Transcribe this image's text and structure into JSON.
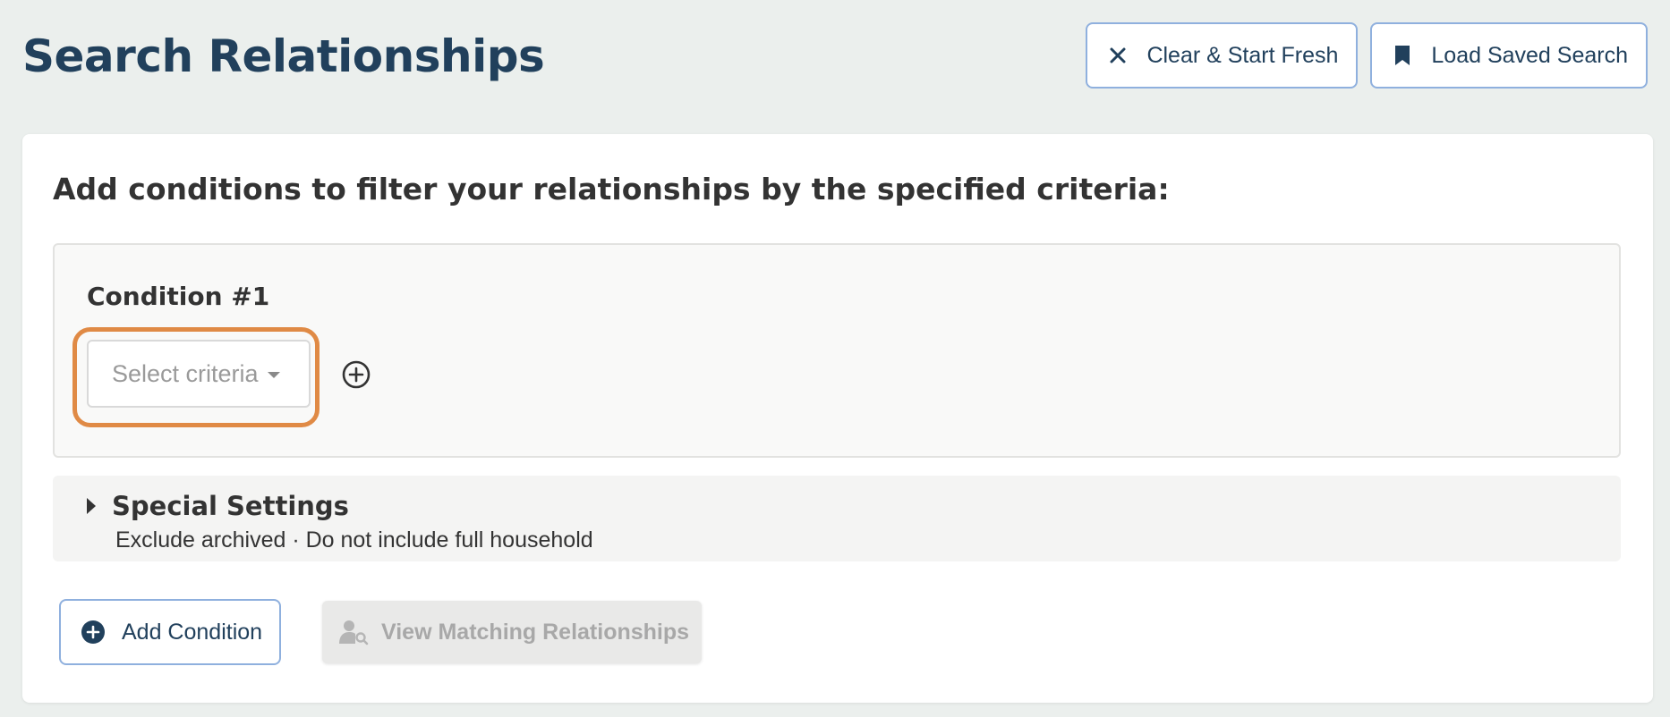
{
  "header": {
    "title": "Search Relationships",
    "actions": {
      "clear_label": "Clear & Start Fresh",
      "load_label": "Load Saved Search"
    }
  },
  "card": {
    "heading": "Add conditions to filter your relationships by the specified criteria:",
    "condition": {
      "title": "Condition #1",
      "criteria_placeholder": "Select criteria"
    },
    "special_settings": {
      "title": "Special Settings",
      "summary": "Exclude archived · Do not include full household"
    },
    "buttons": {
      "add_condition_label": "Add Condition",
      "view_matching_label": "View Matching Relationships"
    }
  },
  "icons": {
    "clear": "close-icon",
    "load": "bookmark-icon",
    "add_criteria": "plus-circle-icon",
    "settings_toggle": "caret-right-icon",
    "add_condition": "plus-circle-filled-icon",
    "view_matching": "user-search-icon"
  },
  "colors": {
    "background": "#ebefed",
    "title": "#21405c",
    "button_border": "#8fb0de",
    "highlight": "#e08a45",
    "disabled_text": "#a8a8a8"
  }
}
